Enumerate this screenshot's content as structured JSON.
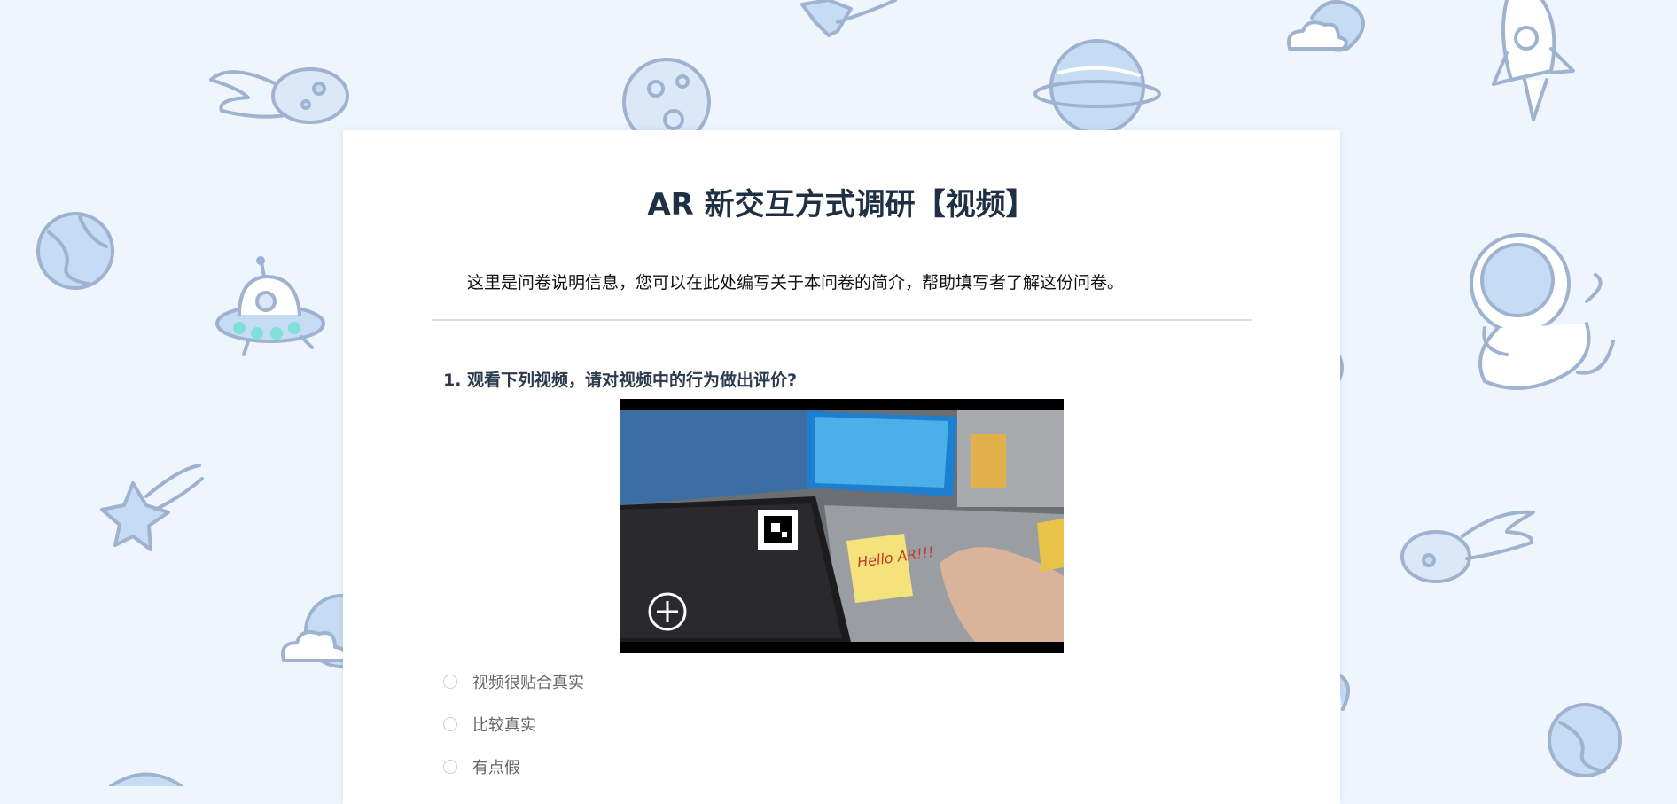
{
  "survey": {
    "title": "AR 新交互方式调研【视频】",
    "description": "这里是问卷说明信息，您可以在此处编写关于本问卷的简介，帮助填写者了解这份问卷。"
  },
  "question1": {
    "text": "1. 观看下列视频，请对视频中的行为做出评价?",
    "video_note_text": "Hello AR!!!",
    "video_icon": "add-icon",
    "options": [
      {
        "label": "视频很贴合真实"
      },
      {
        "label": "比较真实"
      },
      {
        "label": "有点假"
      }
    ]
  },
  "colors": {
    "background": "#eef5fd",
    "title": "#1f3044",
    "question": "#2b3a4d",
    "option_text": "#666666",
    "doodle_stroke": "#9fb2cf",
    "doodle_fill": "#c6dcf5"
  }
}
